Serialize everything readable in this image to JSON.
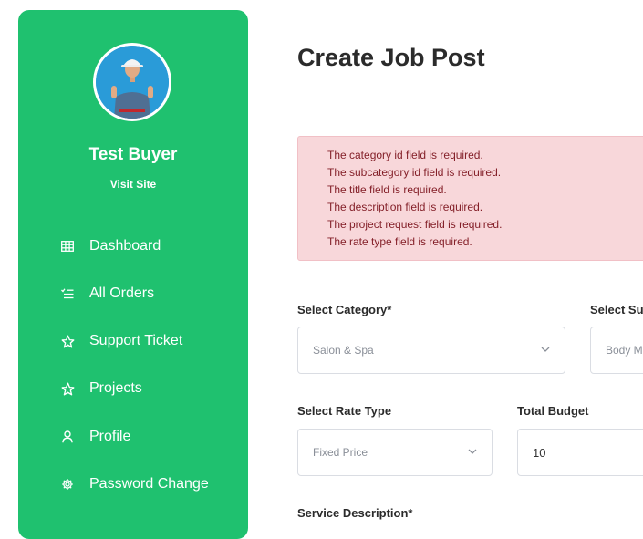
{
  "sidebar": {
    "user_name": "Test Buyer",
    "visit_site": "Visit Site",
    "items": [
      {
        "label": "Dashboard",
        "icon": "grid-icon"
      },
      {
        "label": "All Orders",
        "icon": "list-check-icon"
      },
      {
        "label": "Support Ticket",
        "icon": "star-icon"
      },
      {
        "label": "Projects",
        "icon": "star-icon"
      },
      {
        "label": "Profile",
        "icon": "user-icon"
      },
      {
        "label": "Password Change",
        "icon": "gear-icon"
      }
    ]
  },
  "main": {
    "title": "Create Job Post",
    "errors": [
      "The category id field is required.",
      "The subcategory id field is required.",
      "The title field is required.",
      "The description field is required.",
      "The project request field is required.",
      "The rate type field is required."
    ],
    "category": {
      "label": "Select Category*",
      "value": "Salon & Spa"
    },
    "subcategory": {
      "label": "Select Sul",
      "value": "Body M"
    },
    "rate_type": {
      "label": "Select Rate Type",
      "value": "Fixed Price"
    },
    "total_budget": {
      "label": "Total Budget",
      "value": "10"
    },
    "service_description": {
      "label": "Service Description*"
    }
  },
  "colors": {
    "sidebar_bg": "#1fc16f",
    "alert_bg": "#f8d7da",
    "alert_text": "#842029"
  }
}
